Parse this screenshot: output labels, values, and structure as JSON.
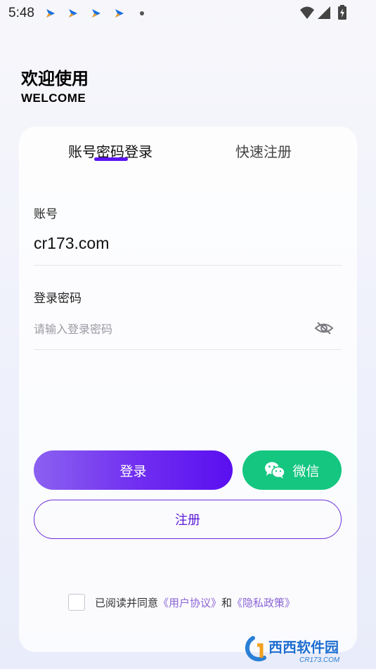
{
  "status_bar": {
    "time": "5:48"
  },
  "welcome": {
    "title_cn": "欢迎使用",
    "title_en": "WELCOME"
  },
  "tabs": {
    "login": "账号密码登录",
    "register": "快速注册"
  },
  "form": {
    "account_label": "账号",
    "account_value": "cr173.com",
    "password_label": "登录密码",
    "password_placeholder": "请输入登录密码"
  },
  "buttons": {
    "login": "登录",
    "wechat": "微信",
    "register": "注册"
  },
  "agreement": {
    "prefix": "已阅读并同意",
    "user_agreement": "《用户协议》",
    "and": "和",
    "privacy_policy": "《隐私政策》"
  },
  "watermark": {
    "name": "西西软件园",
    "url": "CR173.COM"
  },
  "colors": {
    "accent": "#5b14f0",
    "wechat": "#14c680",
    "link": "#8b64d6"
  },
  "icons": [
    "arrow-notification-icon",
    "wifi-icon",
    "signal-icon",
    "battery-charging-icon",
    "eye-hidden-icon",
    "wechat-icon"
  ]
}
